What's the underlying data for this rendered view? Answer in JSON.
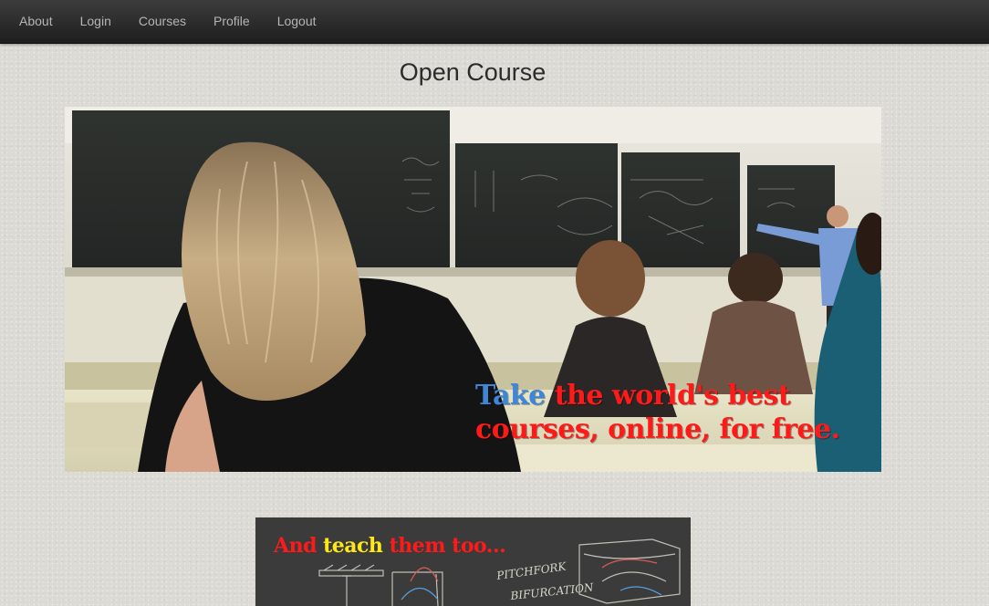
{
  "nav": {
    "items": [
      {
        "label": "About"
      },
      {
        "label": "Login"
      },
      {
        "label": "Courses"
      },
      {
        "label": "Profile"
      },
      {
        "label": "Logout"
      }
    ]
  },
  "page": {
    "title": "Open Course"
  },
  "hero": {
    "tagline_word_1": "Take",
    "tagline_rest_1": " the world's best",
    "tagline_line_2": "courses, online, for free.",
    "accent_color": "#3d86d8",
    "text_color": "#ff1a1a"
  },
  "promo": {
    "tagline_part_1": "And ",
    "tagline_highlight": "teach",
    "tagline_part_2": " them too...",
    "chalk_text_1": "PITCHFORK",
    "chalk_text_2": "BIFURCATION",
    "highlight_color": "#ffe81a"
  }
}
